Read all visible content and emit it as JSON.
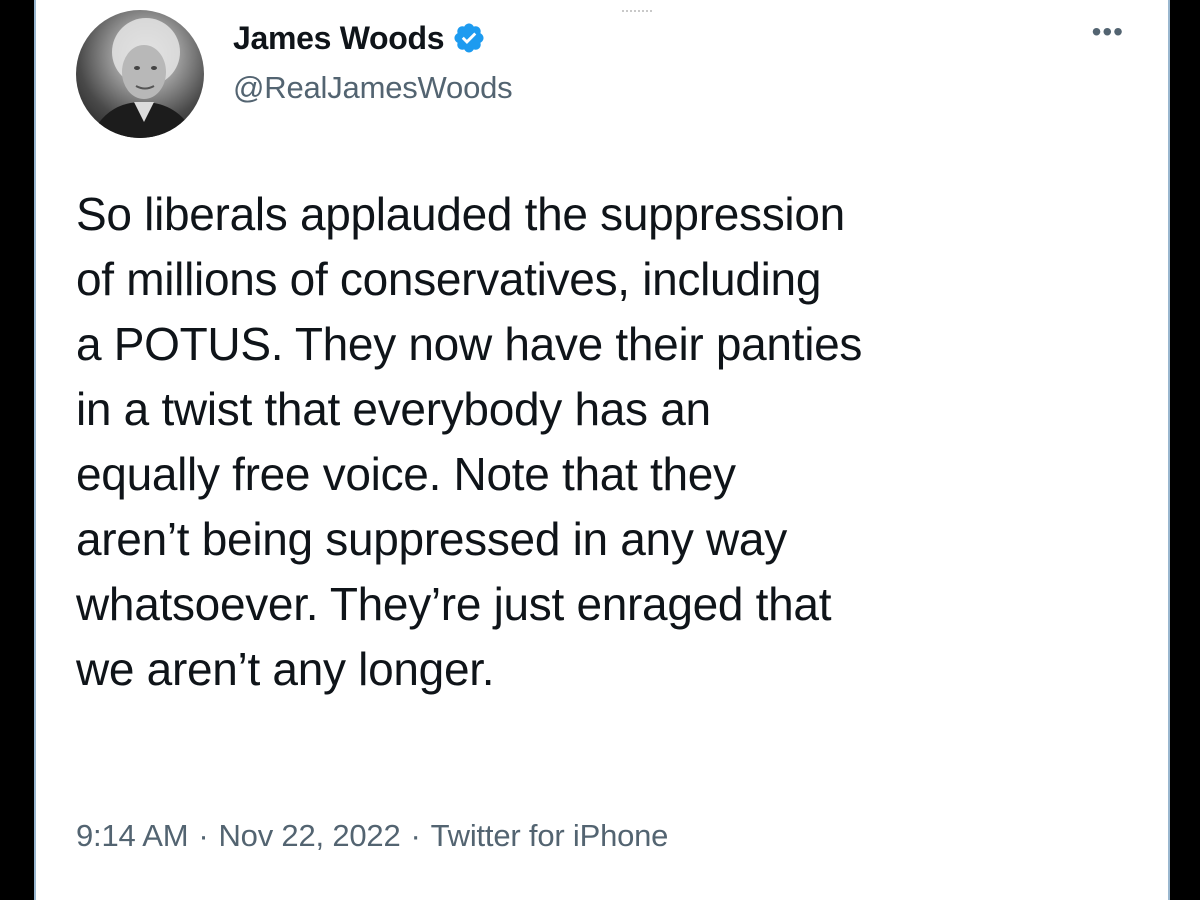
{
  "tweet": {
    "author": {
      "name": "James Woods",
      "handle": "@RealJamesWoods",
      "verified_icon": "verified-badge-icon",
      "verified_color": "#1d9bf0"
    },
    "more_icon": "•••",
    "text": "So liberals applauded the suppression\nof millions of conservatives, including\na POTUS. They now have their panties\nin a twist that everybody has an\nequally free voice. Note that they\naren’t being suppressed in any way\nwhatsoever. They’re just enraged that\nwe aren’t any longer.",
    "time": "9:14 AM",
    "separator": "·",
    "date": "Nov 22, 2022",
    "source": "Twitter for iPhone"
  }
}
